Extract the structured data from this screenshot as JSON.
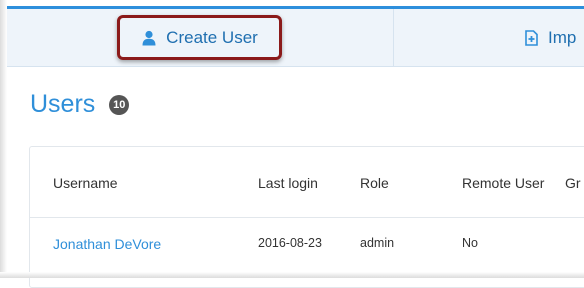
{
  "tabs": {
    "create_user": {
      "label": "Create User",
      "icon": "user-icon"
    },
    "import": {
      "label": "Imp",
      "icon": "import-file-icon"
    }
  },
  "page": {
    "title": "Users",
    "count": "10"
  },
  "table": {
    "columns": [
      "Username",
      "Last login",
      "Role",
      "Remote User",
      "Gr"
    ],
    "rows": [
      {
        "username": "Jonathan DeVore",
        "last_login": "2016-08-23",
        "role": "admin",
        "remote_user": "No"
      }
    ]
  },
  "colors": {
    "accent": "#2f8fd9",
    "highlight": "#8b1a1a",
    "badge": "#555555"
  }
}
